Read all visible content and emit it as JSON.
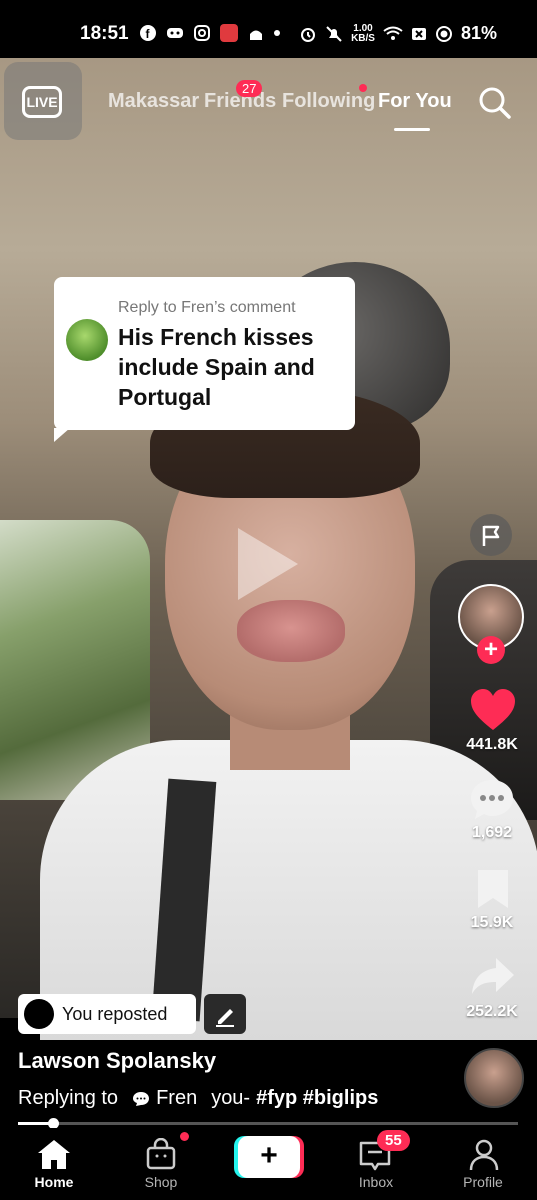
{
  "status_bar": {
    "time": "18:51",
    "network_speed_value": "1.00",
    "network_speed_unit": "KB/S",
    "battery": "81%"
  },
  "top_nav": {
    "live_label": "LIVE",
    "tabs": [
      {
        "label": "Makassar"
      },
      {
        "label": "Friends",
        "badge": "27"
      },
      {
        "label": "Following"
      },
      {
        "label": "For You"
      }
    ],
    "active_tab": "For You"
  },
  "reply_card": {
    "header": "Reply to Fren’s comment",
    "text": "His French kisses include Spain and Portugal"
  },
  "rail": {
    "likes": "441.8K",
    "comments": "1,692",
    "saves": "15.9K",
    "shares": "252.2K"
  },
  "video_info": {
    "repost_label": "You reposted",
    "username": "Lawson Spolansky",
    "caption_prefix": "Replying to",
    "caption_user": "Fren",
    "caption_text": "you-",
    "hashtags": "#fyp #biglips",
    "progress": 0.07
  },
  "tab_bar": {
    "home": "Home",
    "shop": "Shop",
    "inbox": "Inbox",
    "inbox_badge": "55",
    "profile": "Profile"
  },
  "colors": {
    "accent_red": "#fe2c55",
    "accent_cyan": "#25f4ee",
    "like_red": "#fe2c55"
  }
}
